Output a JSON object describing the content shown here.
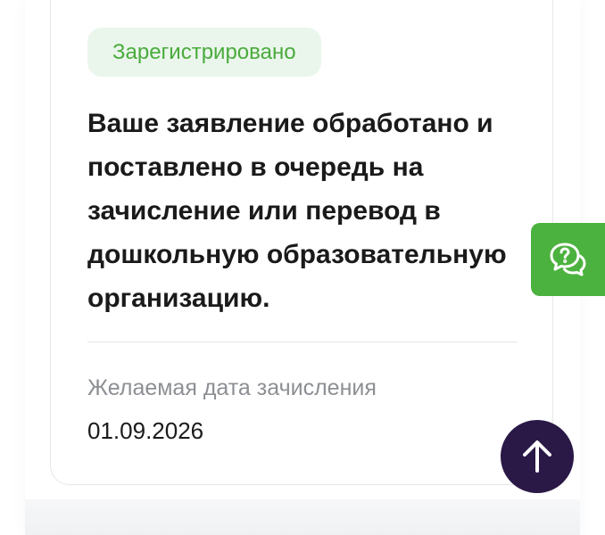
{
  "card": {
    "status_badge": "Зарегистрировано",
    "status_message": "Ваше заявление обработано и поставлено в очередь на зачисление или перевод в дошкольную образовательную организацию.",
    "field_label": "Желаемая дата зачисления",
    "field_value": "01.09.2026"
  },
  "floating_buttons": {
    "chat_icon": "chat-question-icon",
    "scroll_top_icon": "arrow-up-icon"
  },
  "colors": {
    "badge_bg": "#eaf6ec",
    "badge_text": "#4aab3c",
    "chat_button": "#4cb23f",
    "scroll_top_button": "#2a1846",
    "primary_text": "#1a1a1a",
    "secondary_text": "#8c8f93"
  }
}
